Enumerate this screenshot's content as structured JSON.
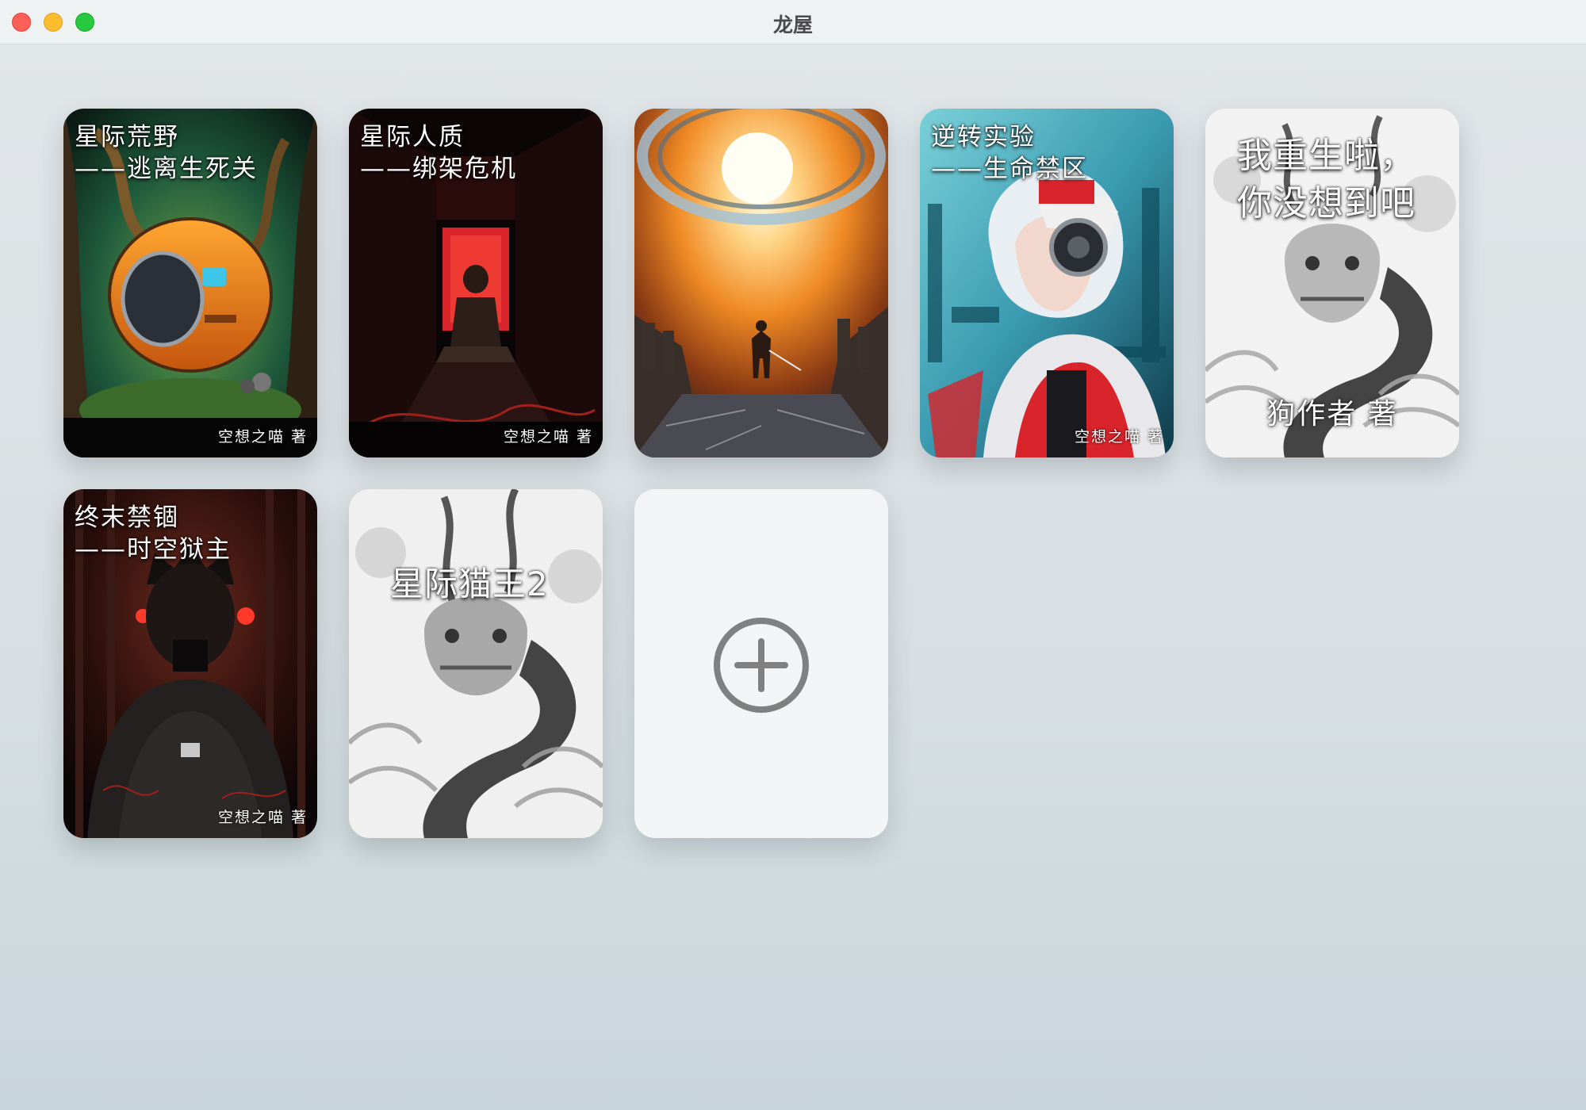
{
  "window": {
    "title": "龙屋"
  },
  "books": [
    {
      "title": "星际荒野\n——逃离生死关",
      "author": "空想之喵 著",
      "art": "forest-capsule"
    },
    {
      "title": "星际人质\n——绑架危机",
      "author": "空想之喵 著",
      "art": "red-corridor"
    },
    {
      "title": "",
      "author": "",
      "art": "warrior-portal"
    },
    {
      "title": "逆转实验\n——生命禁区",
      "author": "空想之喵 著",
      "art": "cyber-girl"
    },
    {
      "title": "我重生啦，\n你没想到吧",
      "author": "狗作者 著",
      "art": "ink-dragon"
    },
    {
      "title": "终末禁锢\n——时空狱主",
      "author": "空想之喵 著",
      "art": "dark-figure"
    },
    {
      "title": "星际猫王2",
      "author": "",
      "art": "ink-dragon"
    }
  ],
  "add_button": {
    "icon": "plus-circle-icon"
  },
  "colors": {
    "close": "#fe5f57",
    "minimize": "#febc2e",
    "maximize": "#28c840",
    "accent_red": "#d8242a",
    "accent_orange": "#f08a24"
  }
}
